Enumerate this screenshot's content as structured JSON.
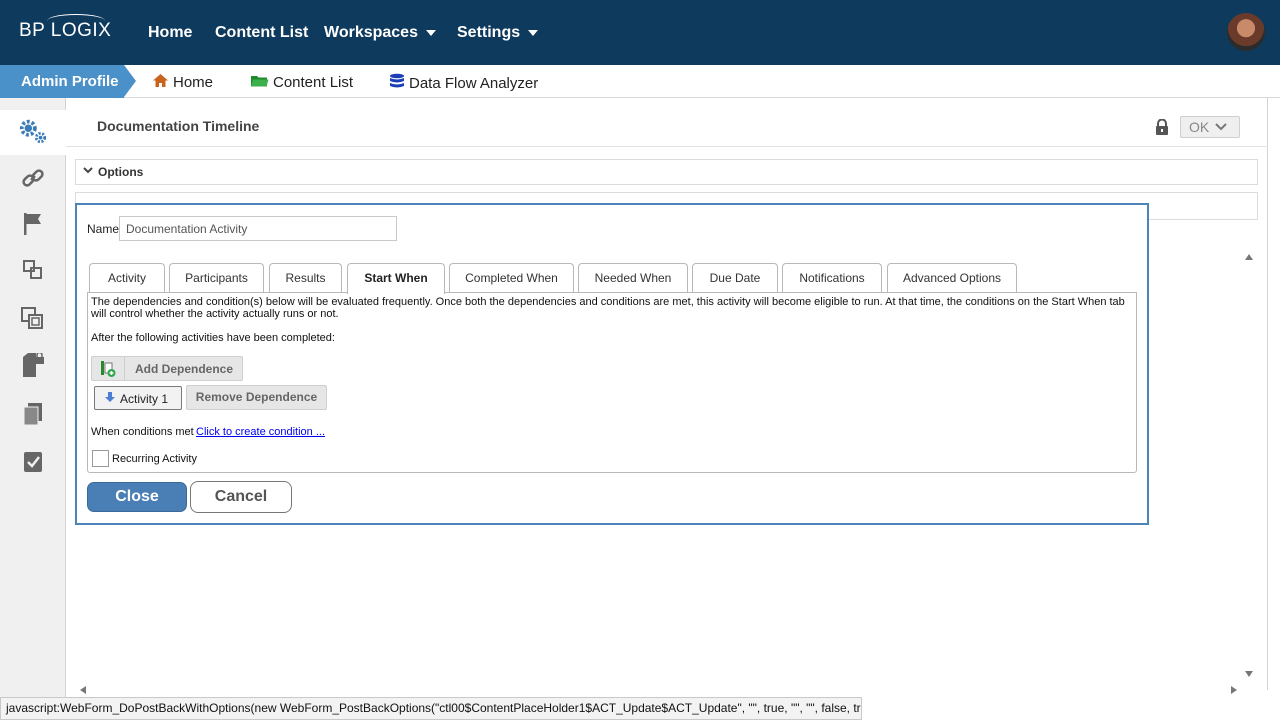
{
  "brand": {
    "logo_text": "BP LOGIX"
  },
  "topnav": {
    "items": [
      {
        "label": "Home"
      },
      {
        "label": "Content List"
      },
      {
        "label": "Workspaces"
      },
      {
        "label": "Settings"
      }
    ]
  },
  "breadcrumb": {
    "profile": "Admin Profile",
    "items": [
      {
        "label": "Home",
        "icon": "home-icon"
      },
      {
        "label": "Content List",
        "icon": "folder-icon"
      },
      {
        "label": "Data Flow Analyzer",
        "icon": "database-icon"
      }
    ]
  },
  "sidebar": {
    "icons": [
      "gears-icon",
      "link-icon",
      "flag-icon",
      "nodes-icon",
      "copy-icon",
      "lock-file-icon",
      "documents-icon",
      "checklist-icon"
    ]
  },
  "header": {
    "title": "Documentation Timeline",
    "ok_label": "OK"
  },
  "options": {
    "label": "Options"
  },
  "dialog": {
    "name_label": "Name",
    "name_value": "Documentation Activity",
    "tabs": [
      {
        "label": "Activity"
      },
      {
        "label": "Participants"
      },
      {
        "label": "Results"
      },
      {
        "label": "Start When",
        "active": true
      },
      {
        "label": "Completed When"
      },
      {
        "label": "Needed When"
      },
      {
        "label": "Due Date"
      },
      {
        "label": "Notifications"
      },
      {
        "label": "Advanced Options"
      }
    ],
    "description": "The dependencies and condition(s) below will be evaluated frequently. Once both the dependencies and conditions are met, this activity will become eligible to run. At that time, the conditions on the Start When tab will control whether the activity actually runs or not.",
    "after_text": "After the following activities have been completed:",
    "add_dependence": "Add Dependence",
    "activity_button": "Activity 1",
    "remove_dependence": "Remove Dependence",
    "conditions_label": "When conditions met",
    "conditions_link": "Click to create condition ...",
    "recurring_label": "Recurring Activity",
    "recurring_checked": false,
    "close_label": "Close",
    "cancel_label": "Cancel"
  },
  "statusbar": {
    "text": "javascript:WebForm_DoPostBackWithOptions(new WebForm_PostBackOptions(\"ctl00$ContentPlaceHolder1$ACT_Update$ACT_Update\", \"\", true, \"\", \"\", false, true))"
  },
  "colors": {
    "nav_bg": "#0e3a5e",
    "accent": "#4a90c9",
    "close_button": "#4a7fb5",
    "link": "#0000ee"
  }
}
